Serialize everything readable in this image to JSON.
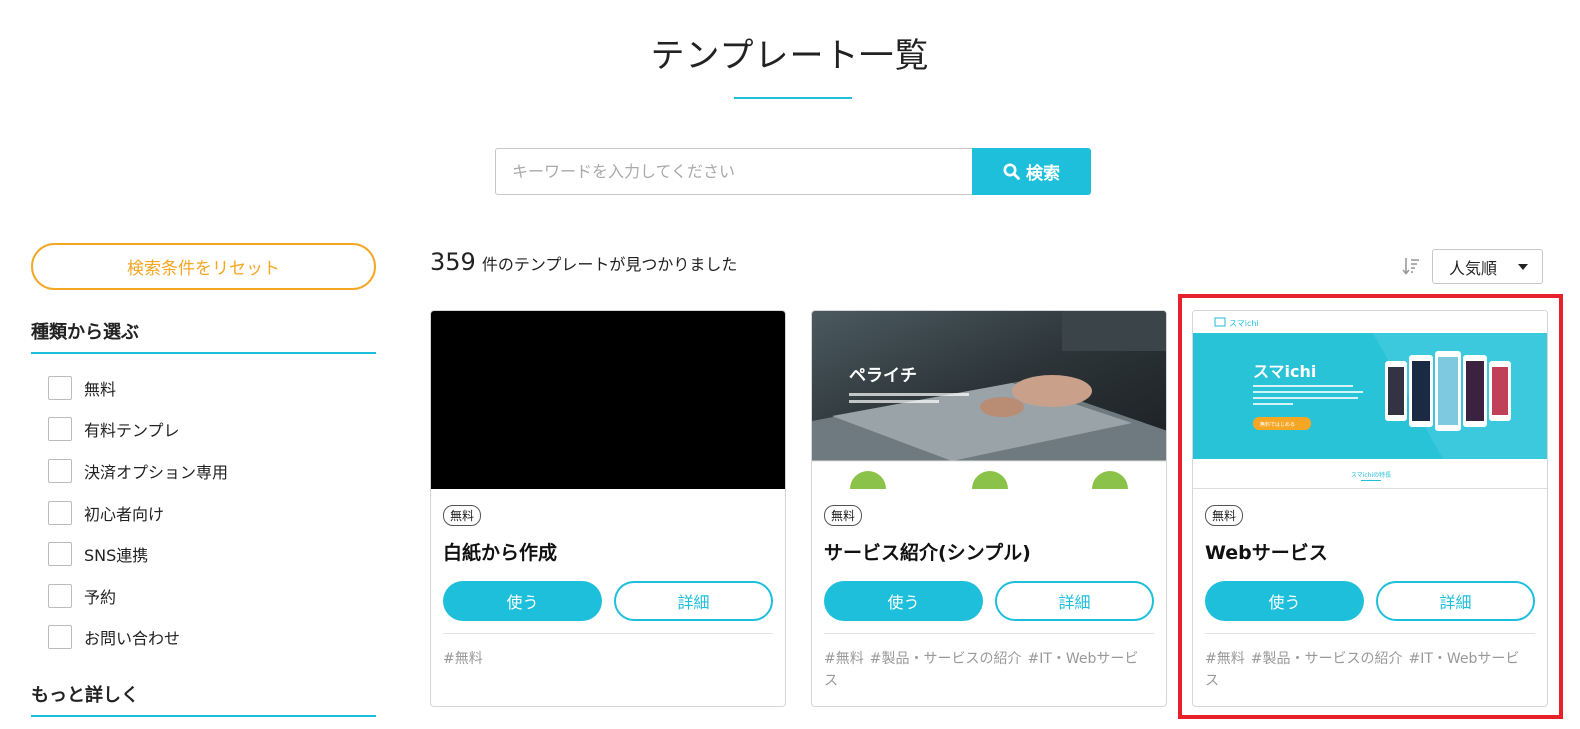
{
  "page": {
    "title": "テンプレート一覧"
  },
  "search": {
    "placeholder": "キーワードを入力してください",
    "button_label": "検索"
  },
  "sidebar": {
    "reset_label": "検索条件をリセット",
    "type_heading": "種類から選ぶ",
    "filters": [
      {
        "label": "無料"
      },
      {
        "label": "有料テンプレ"
      },
      {
        "label": "決済オプション専用"
      },
      {
        "label": "初心者向け"
      },
      {
        "label": "SNS連携"
      },
      {
        "label": "予約"
      },
      {
        "label": "お問い合わせ"
      }
    ],
    "more_heading": "もっと詳しく"
  },
  "results": {
    "count": "359",
    "count_text": "件のテンプレートが見つかりました",
    "sort_label": "人気順"
  },
  "cards": [
    {
      "badge": "無料",
      "title": "白紙から作成",
      "use_label": "使う",
      "detail_label": "詳細",
      "tags": [
        "#無料"
      ]
    },
    {
      "badge": "無料",
      "title": "サービス紹介(シンプル)",
      "use_label": "使う",
      "detail_label": "詳細",
      "thumb_brand": "ペライチ",
      "tags": [
        "#無料",
        "#製品・サービスの紹介",
        "#IT・Webサービス"
      ]
    },
    {
      "badge": "無料",
      "title": "Webサービス",
      "use_label": "使う",
      "detail_label": "詳細",
      "thumb_logo": "スマichi",
      "thumb_headline": "スマichi",
      "thumb_cta": "無料ではじめる",
      "thumb_section": "スマichiの特長",
      "tags": [
        "#無料",
        "#製品・サービスの紹介",
        "#IT・Webサービス"
      ]
    }
  ],
  "colors": {
    "accent": "#1ebfda",
    "reset": "#f5a623",
    "highlight": "#e8202a"
  }
}
